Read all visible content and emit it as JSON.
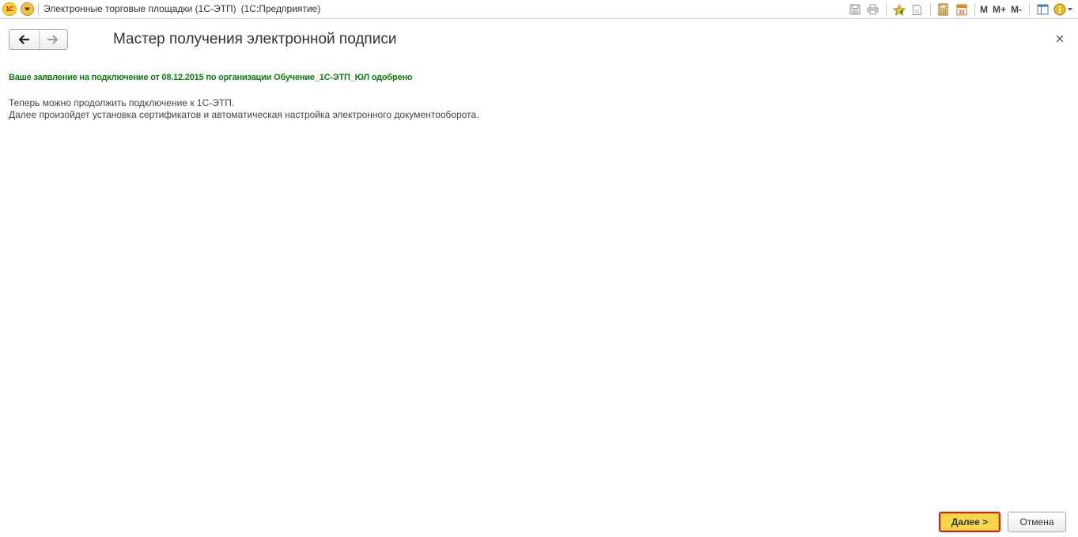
{
  "window": {
    "title": "Электронные торговые площадки (1С-ЭТП)",
    "subtitle": "(1С:Предприятие)",
    "logo_text": "1С"
  },
  "toolbar": {
    "m_label": "M",
    "m_plus_label": "M+",
    "m_minus_label": "M-",
    "calendar_day": "31"
  },
  "form": {
    "title": "Мастер получения электронной подписи",
    "status": "Ваше заявление на подключение от 08.12.2015 по организации Обучение_1С-ЭТП_ЮЛ одобрено",
    "info_line_1": "Теперь можно продолжить подключение к 1С-ЭТП.",
    "info_line_2": "Далее произойдет установка сертификатов и автоматическая настройка электронного документооборота."
  },
  "buttons": {
    "next": "Далее >",
    "cancel": "Отмена"
  },
  "colors": {
    "status_green": "#0f7a0f",
    "accent_yellow": "#f7d64b",
    "highlight_red": "#c8232c"
  }
}
